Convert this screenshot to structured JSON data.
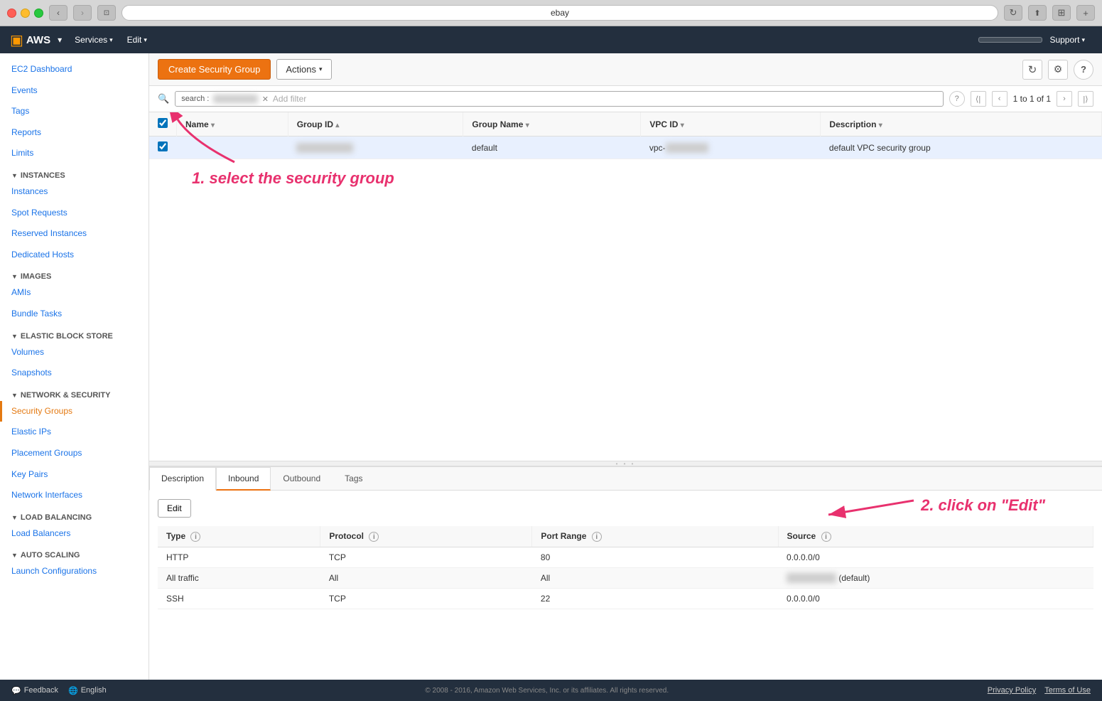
{
  "browser": {
    "address": "ebay",
    "traffic_lights": [
      "red",
      "yellow",
      "green"
    ]
  },
  "aws_nav": {
    "logo": "▣",
    "brand": "AWS",
    "menus": [
      {
        "label": "Services",
        "id": "services-menu"
      },
      {
        "label": "Edit",
        "id": "edit-menu"
      }
    ],
    "support_label": "Support"
  },
  "toolbar": {
    "create_label": "Create Security Group",
    "actions_label": "Actions",
    "refresh_icon": "↻",
    "settings_icon": "⚙",
    "help_icon": "?"
  },
  "search": {
    "tag_label": "search :",
    "tag_value": "████████",
    "add_filter": "Add filter",
    "pagination": "1 to 1 of 1",
    "help_icon": "?"
  },
  "table": {
    "columns": [
      {
        "label": "Name",
        "id": "col-name"
      },
      {
        "label": "Group ID",
        "id": "col-group-id"
      },
      {
        "label": "Group Name",
        "id": "col-group-name"
      },
      {
        "label": "VPC ID",
        "id": "col-vpc-id"
      },
      {
        "label": "Description",
        "id": "col-description"
      }
    ],
    "rows": [
      {
        "selected": true,
        "name": "",
        "group_id": "sg-████████",
        "group_name": "default",
        "vpc_id": "vpc-████████",
        "description": "default VPC security group"
      }
    ]
  },
  "annotation": {
    "step1": "1. select the security group",
    "step2": "2. click on \"Edit\""
  },
  "detail_panel": {
    "tabs": [
      {
        "label": "Description",
        "id": "tab-description"
      },
      {
        "label": "Inbound",
        "id": "tab-inbound",
        "active": true
      },
      {
        "label": "Outbound",
        "id": "tab-outbound"
      },
      {
        "label": "Tags",
        "id": "tab-tags"
      }
    ],
    "edit_button": "Edit",
    "inbound_table": {
      "columns": [
        {
          "label": "Type",
          "id": "col-type"
        },
        {
          "label": "Protocol",
          "id": "col-protocol"
        },
        {
          "label": "Port Range",
          "id": "col-port-range"
        },
        {
          "label": "Source",
          "id": "col-source"
        }
      ],
      "rows": [
        {
          "type": "HTTP",
          "protocol": "TCP",
          "port_range": "80",
          "source": "0.0.0.0/0"
        },
        {
          "type": "All traffic",
          "protocol": "All",
          "port_range": "All",
          "source": "████████ (default)"
        },
        {
          "type": "SSH",
          "protocol": "TCP",
          "port_range": "22",
          "source": "0.0.0.0/0"
        }
      ]
    }
  },
  "sidebar": {
    "top_items": [
      {
        "label": "EC2 Dashboard",
        "id": "ec2-dashboard"
      },
      {
        "label": "Events",
        "id": "events"
      },
      {
        "label": "Tags",
        "id": "tags"
      },
      {
        "label": "Reports",
        "id": "reports"
      },
      {
        "label": "Limits",
        "id": "limits"
      }
    ],
    "sections": [
      {
        "label": "INSTANCES",
        "id": "section-instances",
        "items": [
          {
            "label": "Instances",
            "id": "instances"
          },
          {
            "label": "Spot Requests",
            "id": "spot-requests"
          },
          {
            "label": "Reserved Instances",
            "id": "reserved-instances"
          },
          {
            "label": "Dedicated Hosts",
            "id": "dedicated-hosts"
          }
        ]
      },
      {
        "label": "IMAGES",
        "id": "section-images",
        "items": [
          {
            "label": "AMIs",
            "id": "amis"
          },
          {
            "label": "Bundle Tasks",
            "id": "bundle-tasks"
          }
        ]
      },
      {
        "label": "ELASTIC BLOCK STORE",
        "id": "section-ebs",
        "items": [
          {
            "label": "Volumes",
            "id": "volumes"
          },
          {
            "label": "Snapshots",
            "id": "snapshots"
          }
        ]
      },
      {
        "label": "NETWORK & SECURITY",
        "id": "section-network",
        "items": [
          {
            "label": "Security Groups",
            "id": "security-groups",
            "active": true
          },
          {
            "label": "Elastic IPs",
            "id": "elastic-ips"
          },
          {
            "label": "Placement Groups",
            "id": "placement-groups"
          },
          {
            "label": "Key Pairs",
            "id": "key-pairs"
          },
          {
            "label": "Network Interfaces",
            "id": "network-interfaces"
          }
        ]
      },
      {
        "label": "LOAD BALANCING",
        "id": "section-lb",
        "items": [
          {
            "label": "Load Balancers",
            "id": "load-balancers"
          }
        ]
      },
      {
        "label": "AUTO SCALING",
        "id": "section-autoscaling",
        "items": [
          {
            "label": "Launch Configurations",
            "id": "launch-configurations"
          }
        ]
      }
    ]
  },
  "footer": {
    "feedback_label": "Feedback",
    "language_label": "English",
    "copyright": "© 2008 - 2016, Amazon Web Services, Inc. or its affiliates. All rights reserved.",
    "privacy_policy": "Privacy Policy",
    "terms_of_use": "Terms of Use"
  }
}
